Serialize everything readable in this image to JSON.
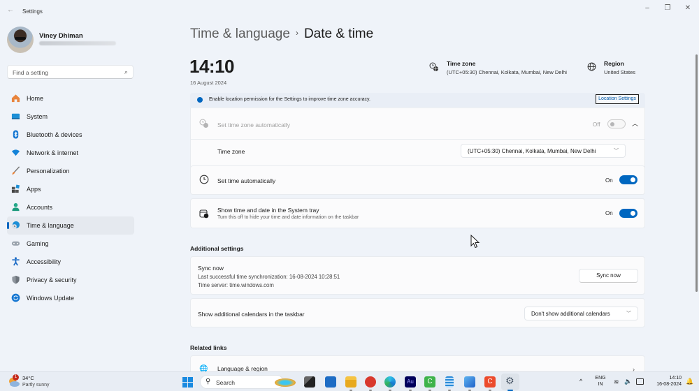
{
  "window": {
    "title": "Settings",
    "controls": {
      "minimize": "–",
      "maximize": "❐",
      "close": "✕"
    }
  },
  "profile": {
    "name": "Viney Dhiman",
    "email_redacted": true
  },
  "search": {
    "placeholder": "Find a setting"
  },
  "sidebar": {
    "items": [
      {
        "label": "Home",
        "icon": "home-icon",
        "active": false
      },
      {
        "label": "System",
        "icon": "system-icon",
        "active": false
      },
      {
        "label": "Bluetooth & devices",
        "icon": "bluetooth-icon",
        "active": false
      },
      {
        "label": "Network & internet",
        "icon": "wifi-icon",
        "active": false
      },
      {
        "label": "Personalization",
        "icon": "brush-icon",
        "active": false
      },
      {
        "label": "Apps",
        "icon": "apps-icon",
        "active": false
      },
      {
        "label": "Accounts",
        "icon": "accounts-icon",
        "active": false
      },
      {
        "label": "Time & language",
        "icon": "time-language-icon",
        "active": true
      },
      {
        "label": "Gaming",
        "icon": "gaming-icon",
        "active": false
      },
      {
        "label": "Accessibility",
        "icon": "accessibility-icon",
        "active": false
      },
      {
        "label": "Privacy & security",
        "icon": "shield-icon",
        "active": false
      },
      {
        "label": "Windows Update",
        "icon": "update-icon",
        "active": false
      }
    ]
  },
  "breadcrumb": {
    "parent": "Time & language",
    "separator": "›",
    "current": "Date & time"
  },
  "clock": {
    "time": "14:10",
    "date": "16 August 2024"
  },
  "header": {
    "timezone": {
      "title": "Time zone",
      "value": "(UTC+05:30) Chennai, Kolkata, Mumbai, New Delhi"
    },
    "region": {
      "title": "Region",
      "value": "United States"
    }
  },
  "info_bar": {
    "text": "Enable location permission for the Settings to improve time zone accuracy.",
    "button": "Location Settings"
  },
  "settings": {
    "auto_timezone": {
      "label": "Set time zone automatically",
      "state_label": "Off",
      "on": false,
      "disabled": true
    },
    "timezone": {
      "label": "Time zone",
      "value": "(UTC+05:30) Chennai, Kolkata, Mumbai, New Delhi"
    },
    "auto_time": {
      "label": "Set time automatically",
      "state_label": "On",
      "on": true
    },
    "tray": {
      "label": "Show time and date in the System tray",
      "sub": "Turn this off to hide your time and date information on the taskbar",
      "state_label": "On",
      "on": true
    }
  },
  "additional": {
    "heading": "Additional settings",
    "sync": {
      "title": "Sync now",
      "last": "Last successful time synchronization: 16-08-2024 10:28:51",
      "server": "Time server: time.windows.com",
      "button": "Sync now"
    },
    "calendars": {
      "label": "Show additional calendars in the taskbar",
      "value": "Don't show additional calendars"
    }
  },
  "related": {
    "heading": "Related links",
    "items": [
      {
        "label": "Language & region"
      }
    ]
  },
  "taskbar": {
    "weather": {
      "temp": "34°C",
      "condition": "Partly sunny",
      "badge": "1"
    },
    "search_label": "Search",
    "apps": [
      "widgets",
      "task-view",
      "microsoft-store",
      "file-explorer",
      "app-red",
      "edge",
      "audition",
      "camtasia",
      "notepad",
      "photos",
      "app-c-red",
      "settings"
    ],
    "tray": {
      "lang_top": "ENG",
      "lang_bottom": "IN",
      "time": "14:10",
      "date": "16-08-2024"
    }
  },
  "colors": {
    "accent": "#0067c0",
    "background": "#eff3f9",
    "card": "#fbfbfc"
  }
}
